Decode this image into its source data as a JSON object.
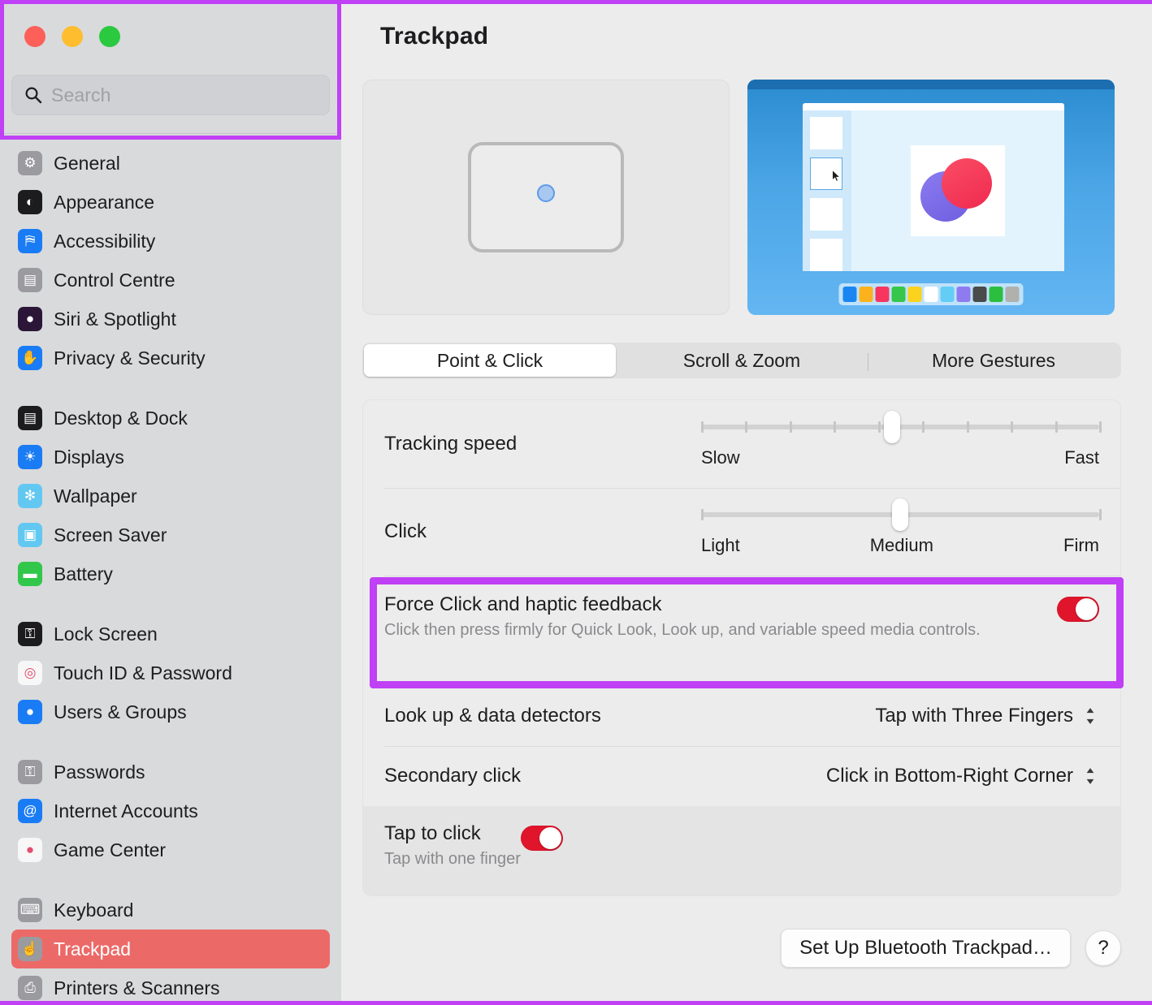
{
  "window": {
    "traffic_lights": [
      "close",
      "minimize",
      "zoom"
    ],
    "colors": {
      "close": "#fc6058",
      "minimize": "#fdbd2f",
      "zoom": "#2ac93f",
      "selected_item": "#eb6a68",
      "toggle_on": "#e0152b",
      "annotation": "#c040f5"
    }
  },
  "search": {
    "placeholder": "Search",
    "icon": "search-icon"
  },
  "sidebar": {
    "groups": [
      {
        "items": [
          {
            "label": "General",
            "icon": "gear-icon",
            "bg": "#9a9a9f",
            "glyph": "⚙"
          },
          {
            "label": "Appearance",
            "icon": "appearance-icon",
            "bg": "#1c1c1e",
            "glyph": "◐"
          },
          {
            "label": "Accessibility",
            "icon": "accessibility-icon",
            "bg": "#1a7cf5",
            "glyph": "⛿"
          },
          {
            "label": "Control Centre",
            "icon": "control-centre-icon",
            "bg": "#9a9a9f",
            "glyph": "▤"
          },
          {
            "label": "Siri & Spotlight",
            "icon": "siri-icon",
            "bg": "#2b1638",
            "glyph": "●"
          },
          {
            "label": "Privacy & Security",
            "icon": "privacy-icon",
            "bg": "#1a7cf5",
            "glyph": "✋"
          }
        ]
      },
      {
        "items": [
          {
            "label": "Desktop & Dock",
            "icon": "desktop-dock-icon",
            "bg": "#1c1c1e",
            "glyph": "▤"
          },
          {
            "label": "Displays",
            "icon": "displays-icon",
            "bg": "#1a7cf5",
            "glyph": "☀"
          },
          {
            "label": "Wallpaper",
            "icon": "wallpaper-icon",
            "bg": "#62c8f2",
            "glyph": "✻"
          },
          {
            "label": "Screen Saver",
            "icon": "screen-saver-icon",
            "bg": "#62c8f2",
            "glyph": "▣"
          },
          {
            "label": "Battery",
            "icon": "battery-icon",
            "bg": "#31c74a",
            "glyph": "▬"
          }
        ]
      },
      {
        "items": [
          {
            "label": "Lock Screen",
            "icon": "lock-screen-icon",
            "bg": "#1c1c1e",
            "glyph": "⚿"
          },
          {
            "label": "Touch ID & Password",
            "icon": "touch-id-icon",
            "bg": "#f7f7f7",
            "glyph": "◎"
          },
          {
            "label": "Users & Groups",
            "icon": "users-groups-icon",
            "bg": "#1a7cf5",
            "glyph": "●"
          }
        ]
      },
      {
        "items": [
          {
            "label": "Passwords",
            "icon": "passwords-icon",
            "bg": "#9a9a9f",
            "glyph": "⚿"
          },
          {
            "label": "Internet Accounts",
            "icon": "internet-accounts-icon",
            "bg": "#1a7cf5",
            "glyph": "@"
          },
          {
            "label": "Game Center",
            "icon": "game-center-icon",
            "bg": "#f7f7f7",
            "glyph": "●"
          }
        ]
      },
      {
        "items": [
          {
            "label": "Keyboard",
            "icon": "keyboard-icon",
            "bg": "#9a9a9f",
            "glyph": "⌨"
          },
          {
            "label": "Trackpad",
            "icon": "trackpad-icon",
            "bg": "#9a9a9f",
            "glyph": "☝",
            "selected": true
          },
          {
            "label": "Printers & Scanners",
            "icon": "printers-scanners-icon",
            "bg": "#9a9a9f",
            "glyph": "⎙"
          }
        ]
      }
    ]
  },
  "main": {
    "title": "Trackpad",
    "tabs": [
      {
        "label": "Point & Click",
        "active": true
      },
      {
        "label": "Scroll & Zoom",
        "active": false
      },
      {
        "label": "More Gestures",
        "active": false
      }
    ],
    "settings": {
      "tracking_speed": {
        "label": "Tracking speed",
        "min_label": "Slow",
        "max_label": "Fast",
        "value": 5,
        "ticks": 10
      },
      "click": {
        "label": "Click",
        "min_label": "Light",
        "mid_label": "Medium",
        "max_label": "Firm",
        "value": 2,
        "ticks": 3
      },
      "force_click": {
        "label": "Force Click and haptic feedback",
        "description": "Click then press firmly for Quick Look, Look up, and variable speed media controls.",
        "enabled": "on"
      },
      "look_up": {
        "label": "Look up & data detectors",
        "value": "Tap with Three Fingers"
      },
      "secondary_click": {
        "label": "Secondary click",
        "value": "Click in Bottom-Right Corner"
      },
      "tap_to_click": {
        "label": "Tap to click",
        "description": "Tap with one finger",
        "enabled": "on"
      }
    },
    "footer": {
      "setup_button": "Set Up Bluetooth Trackpad…",
      "help_button": "?"
    },
    "illustration": {
      "swatches": [
        "#1a85f0",
        "#fbb21c",
        "#f7355f",
        "#35c64a",
        "#fbd21c",
        "#ffffff",
        "#63cdf5",
        "#8f7bf0",
        "#4a4a4a",
        "#2cbe3e",
        "#b0b0ac"
      ]
    }
  }
}
